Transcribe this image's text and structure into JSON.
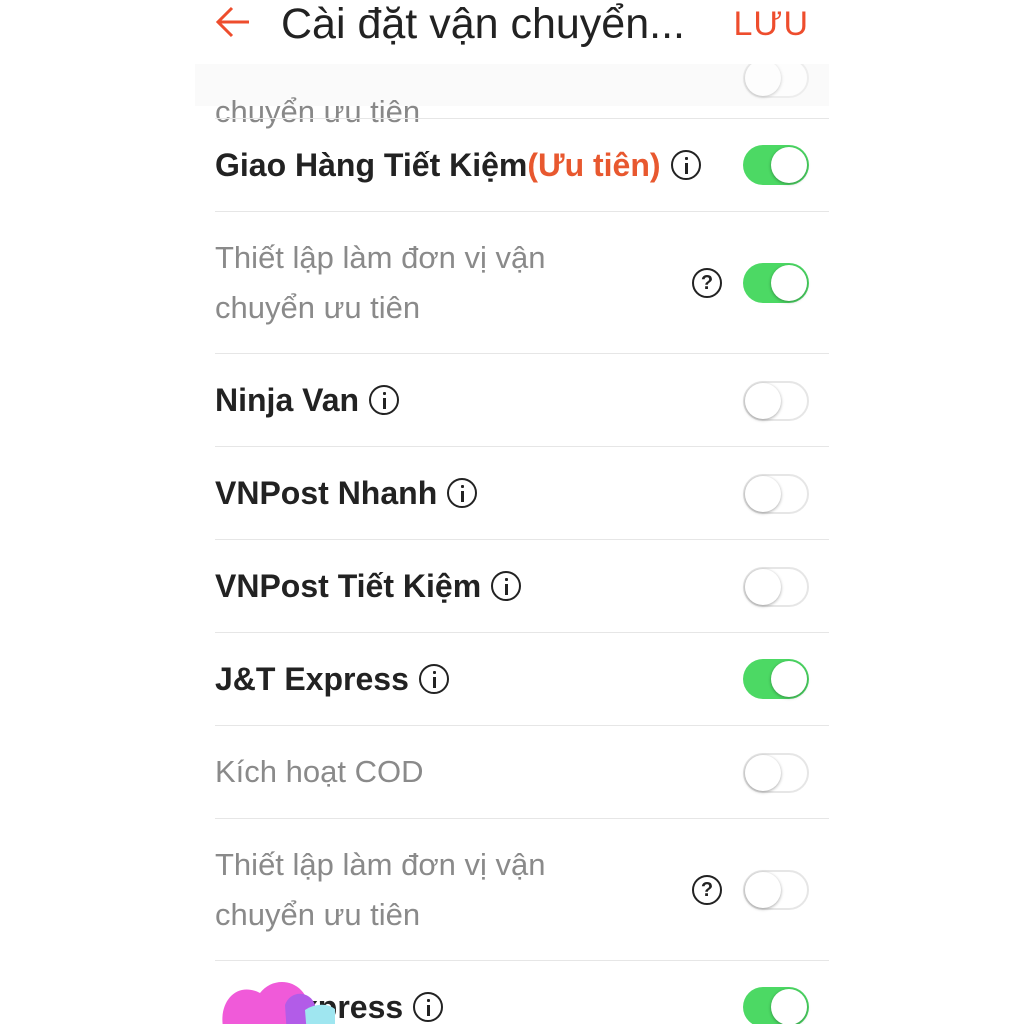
{
  "header": {
    "title": "Cài đặt vận chuyển...",
    "save_label": "LƯU",
    "accent_color": "#ee4d2d"
  },
  "top_partial_text": "chuyển ưu tiên",
  "rows": [
    {
      "label": "Giao Hàng Tiết Kiệm",
      "badge": "(Ưu tiên)",
      "icon": "info-icon",
      "on": true
    },
    {
      "label_line1": "Thiết lập làm đơn vị vận",
      "label_line2": "chuyển ưu tiên",
      "icon": "help-icon",
      "on": true
    },
    {
      "label": "Ninja Van",
      "icon": "info-icon",
      "on": false
    },
    {
      "label": "VNPost Nhanh",
      "icon": "info-icon",
      "on": false
    },
    {
      "label": "VNPost Tiết Kiệm",
      "icon": "info-icon",
      "on": false
    },
    {
      "label": "J&T Express",
      "icon": "info-icon",
      "on": true
    },
    {
      "label": "Kích hoạt COD",
      "on": false
    },
    {
      "label_line1": "Thiết lập làm đơn vị vận",
      "label_line2": "chuyển ưu tiên",
      "icon": "help-icon",
      "on": false
    },
    {
      "label": "xpress",
      "icon": "info-icon",
      "on": true
    }
  ],
  "colors": {
    "toggle_on": "#4cd964",
    "toggle_off_border": "#e6e6e6",
    "priority_text": "#e8582f"
  }
}
